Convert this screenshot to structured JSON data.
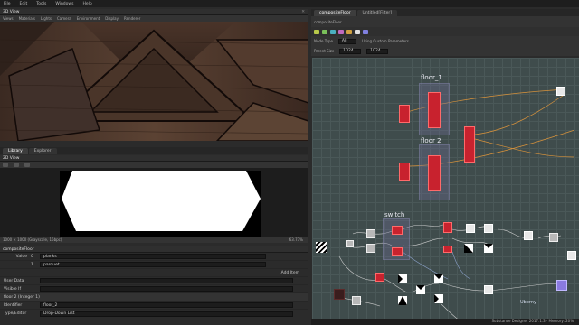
{
  "menubar": {
    "items": [
      "File",
      "Edit",
      "Tools",
      "Windows",
      "Help"
    ]
  },
  "view3d": {
    "title": "3D View",
    "menu": [
      "Views",
      "Materials",
      "Lights",
      "Camera",
      "Environment",
      "Display",
      "Renderer"
    ]
  },
  "library_tabs": [
    "Library",
    "Explorer"
  ],
  "view2d": {
    "title": "2D View",
    "status": "1000 × 1000 (Grayscale, 16bpc)",
    "zoom": "63.73%"
  },
  "params": {
    "title": "compositeFloor",
    "rows": [
      {
        "label": "Value",
        "index": "0",
        "text": "planks"
      },
      {
        "label": "",
        "index": "1",
        "text": "parquet"
      }
    ],
    "add_item": "Add Item",
    "user_data_label": "User Data",
    "visible_label": "Visible If",
    "section": "floor 2 (Integer 1)",
    "identifier_label": "Identifier",
    "identifier_value": "floor_2",
    "type_label": "Type/Editor",
    "type_value": "Drop-Down List"
  },
  "graph": {
    "tabs": [
      "compositeFloor",
      "Untitled[Filter]"
    ],
    "breadcrumb": "compositeFloor",
    "mode_label": "Node Type",
    "mode_value": "All",
    "custom_params_label": "Using Custom Parameters",
    "parent_size_label": "Parent Size",
    "parent_size_values": [
      "1024",
      "1024"
    ],
    "frames": {
      "floor1": "floor_1",
      "floor2": "floor 2",
      "switch": "switch"
    },
    "watermark": "Uberny"
  },
  "status_bar": {
    "text": "Substance Designer 2017.1.3 · Memory: 20%"
  },
  "colors": {
    "graph_bg": "#3f4c4c",
    "node_red": "#c8222e",
    "accent_orange": "#e89a3a"
  }
}
